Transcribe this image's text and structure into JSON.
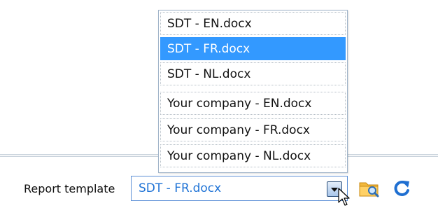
{
  "dropdown": {
    "options": [
      {
        "label": "SDT - EN.docx"
      },
      {
        "label": "SDT - FR.docx"
      },
      {
        "label": "SDT - NL.docx"
      },
      {
        "label": "Your company - EN.docx"
      },
      {
        "label": "Your company - FR.docx"
      },
      {
        "label": "Your company - NL.docx"
      }
    ],
    "selected_label": "SDT - FR.docx"
  },
  "form": {
    "report_template_label": "Report template",
    "report_template_value": "SDT - FR.docx"
  },
  "icons": {
    "browse": "folder-search-icon",
    "refresh": "refresh-icon",
    "dropdown_arrow": "chevron-down-icon",
    "cursor": "mouse-cursor-icon"
  },
  "colors": {
    "selection": "#3399ff",
    "value_text": "#1f73d6",
    "combo_border": "#5b8fd6"
  }
}
